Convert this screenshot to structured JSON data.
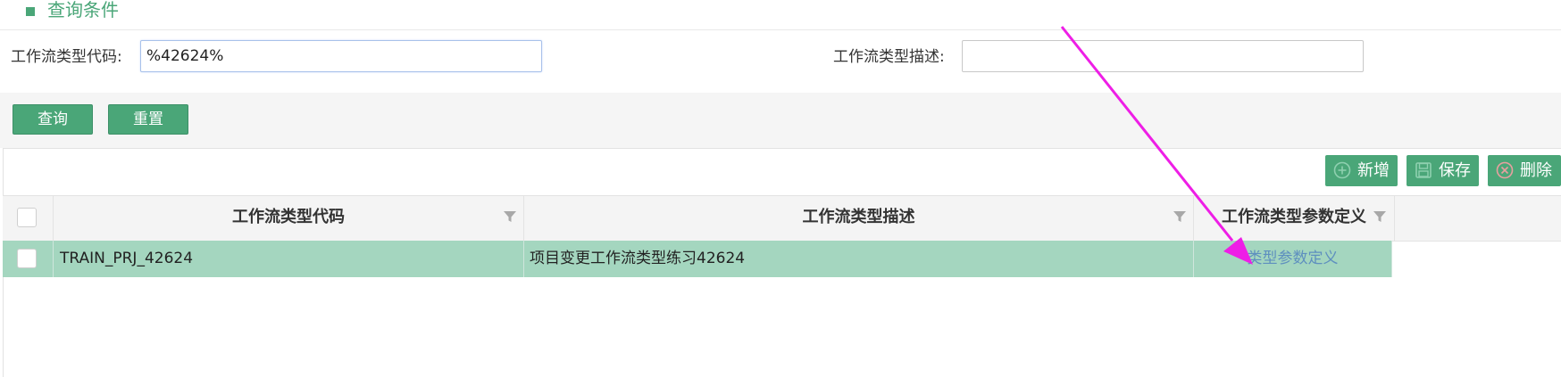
{
  "section": {
    "title": "查询条件"
  },
  "query": {
    "code_label": "工作流类型代码:",
    "code_value": "%42624%",
    "desc_label": "工作流类型描述:",
    "desc_value": ""
  },
  "buttons": {
    "query": "查询",
    "reset": "重置"
  },
  "toolbar": {
    "add": "新增",
    "save": "保存",
    "delete": "删除"
  },
  "table": {
    "columns": [
      "工作流类型代码",
      "工作流类型描述",
      "工作流类型参数定义"
    ],
    "rows": [
      {
        "code": "TRAIN_PRJ_42624",
        "description": "项目变更工作流类型练习42624",
        "param_link": "类型参数定义"
      }
    ]
  },
  "colors": {
    "accent": "#4aa678",
    "row_selected": "#a4d6bf",
    "annotation_arrow": "#ee1ee6"
  }
}
